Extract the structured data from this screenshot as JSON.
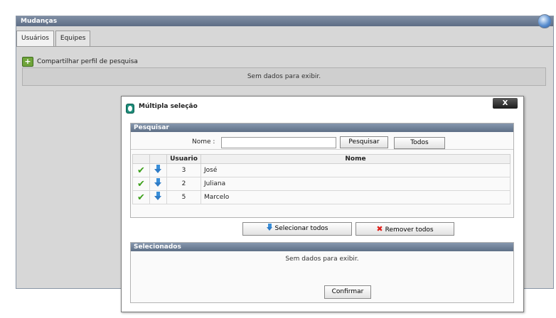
{
  "panel": {
    "title": "Mudanças",
    "tabs": [
      {
        "label": "Usuários"
      },
      {
        "label": "Equipes"
      }
    ],
    "share_label": "Compartilhar perfil de pesquisa",
    "no_data": "Sem dados para exibir."
  },
  "modal": {
    "title": "Múltipla seleção",
    "close_label": "X",
    "search": {
      "section_title": "Pesquisar",
      "name_label": "Nome :",
      "name_value": "",
      "search_button": "Pesquisar",
      "all_button": "Todos"
    },
    "table": {
      "columns": [
        "Usuario",
        "Nome"
      ],
      "rows": [
        {
          "id": "3",
          "name": "José"
        },
        {
          "id": "2",
          "name": "Juliana"
        },
        {
          "id": "5",
          "name": "Marcelo"
        }
      ]
    },
    "select_all_button": "Selecionar todos",
    "remove_all_button": "Remover todos",
    "selected": {
      "section_title": "Selecionados",
      "no_data": "Sem dados para exibir."
    },
    "confirm_button": "Confirmar"
  },
  "colors": {
    "title_bar": "#6b7b92",
    "check": "#3ca01a",
    "arrow": "#2f7cc6",
    "remove": "#e0201b"
  }
}
